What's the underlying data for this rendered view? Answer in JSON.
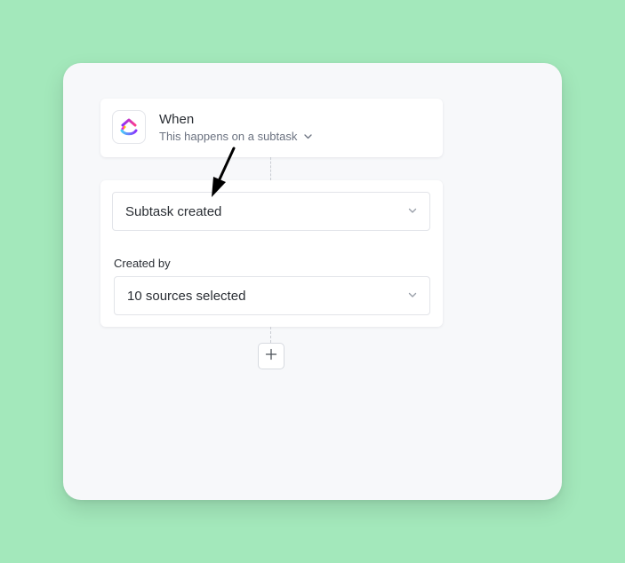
{
  "trigger": {
    "title": "When",
    "subtitle": "This happens on a subtask",
    "app_icon": "clickup-logo"
  },
  "event_select": {
    "value": "Subtask created"
  },
  "created_by": {
    "label": "Created by",
    "value": "10 sources selected"
  },
  "add_step": {
    "icon": "plus-icon"
  },
  "colors": {
    "background": "#a3e8bb",
    "panel": "#f7f8fa",
    "text": "#2a2e34",
    "muted": "#6b7280"
  }
}
